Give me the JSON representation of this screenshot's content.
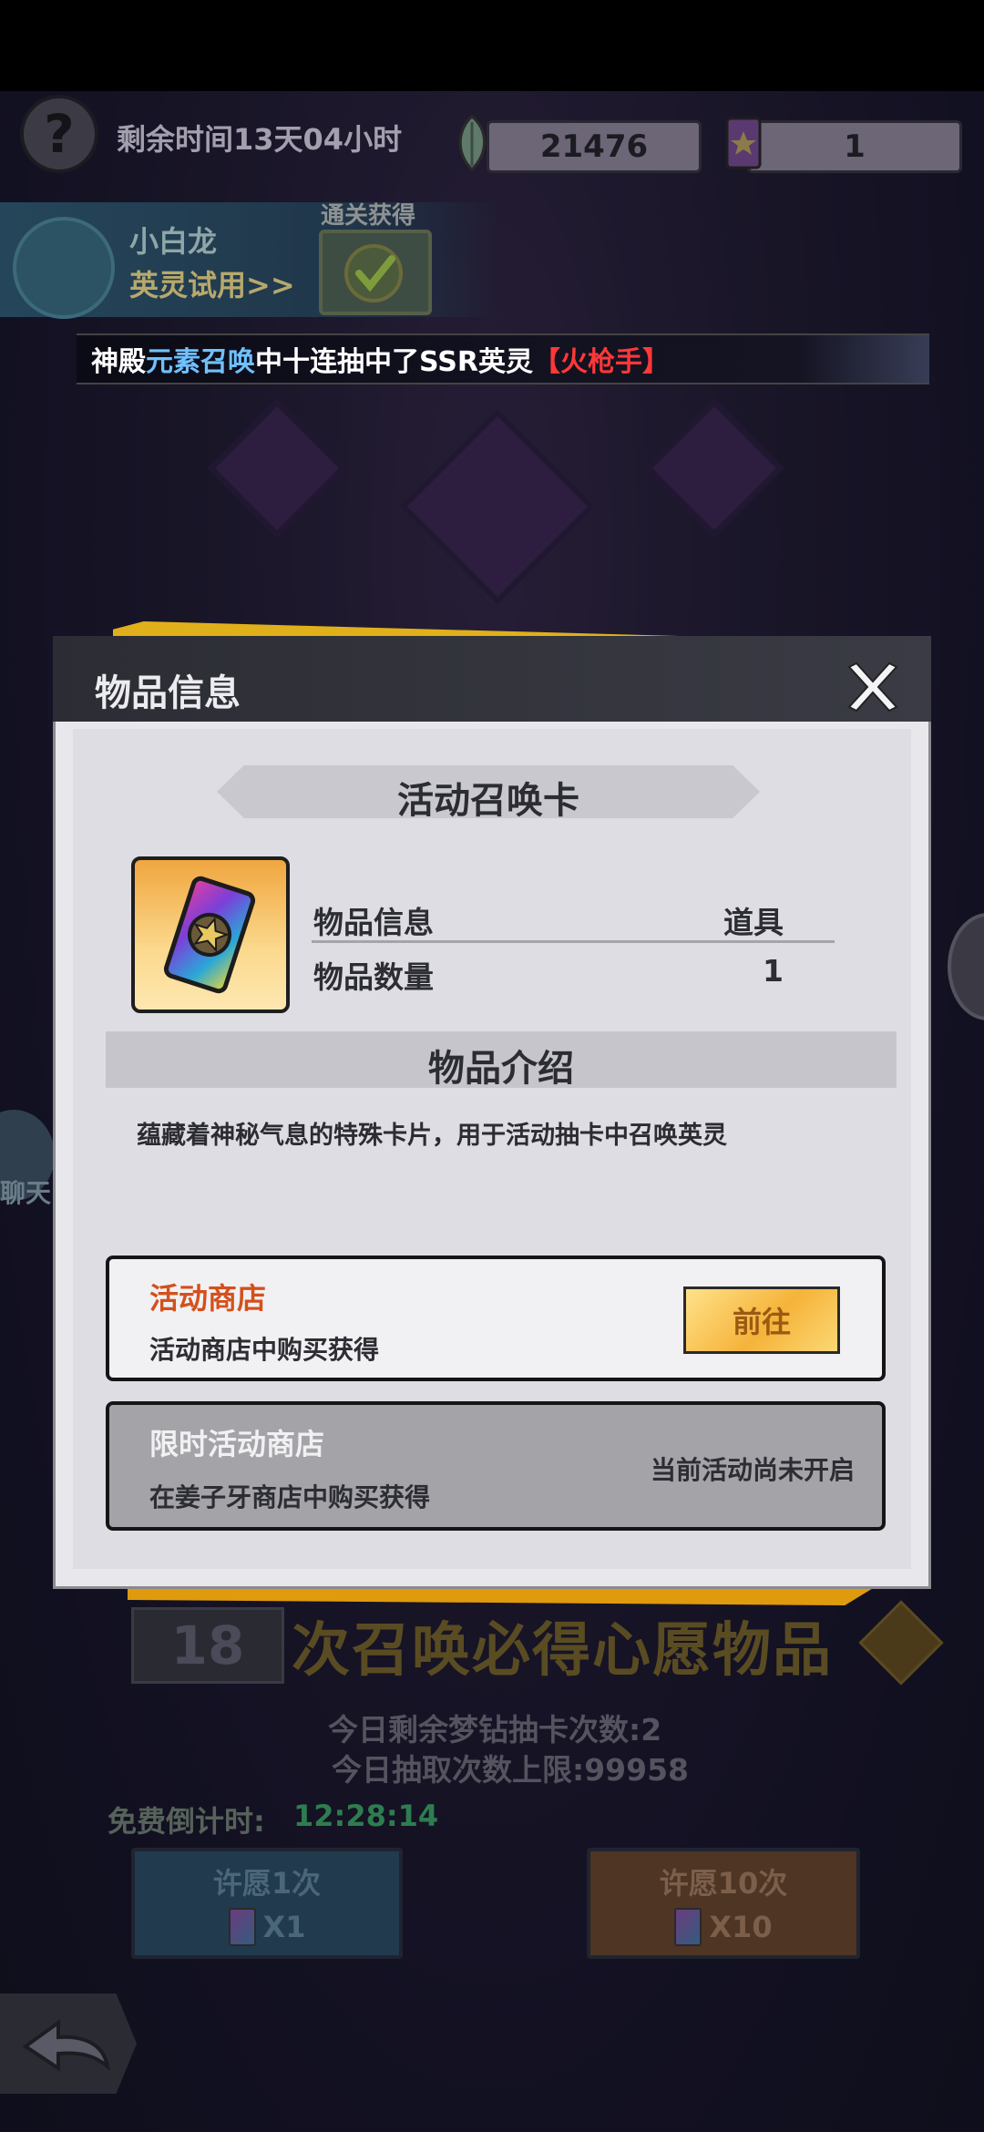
{
  "top_bar": {
    "remaining_time": "剩余时间13天04小时",
    "resources": [
      {
        "icon": "feather-gem-icon",
        "value": "21476"
      },
      {
        "icon": "summon-card-icon",
        "value": "1"
      }
    ]
  },
  "trial_banner": {
    "hero_name": "小白龙",
    "trial_link": "英灵试用>>",
    "reward_label": "通关获得"
  },
  "ticker": {
    "prefix": "神殿",
    "highlight": "元素召唤",
    "middle": "中十连抽中了SSR英灵",
    "hero": "【火枪手】"
  },
  "background_screen": {
    "wish_count": "18",
    "wish_text": "次召唤必得心愿物品",
    "daily_remaining": "今日剩余梦钻抽卡次数:2",
    "daily_limit": "今日抽取次数上限:99958",
    "free_countdown_label": "免费倒计时:",
    "free_countdown_value": "12:28:14",
    "wish_1_label": "许愿1次",
    "wish_1_cost": "X1",
    "wish_10_label": "许愿10次",
    "wish_10_cost": "X10",
    "side_chat_label": "聊天"
  },
  "modal": {
    "title": "物品信息",
    "item_name": "活动召唤卡",
    "info_label": "物品信息",
    "info_value": "道具",
    "count_label": "物品数量",
    "count_value": "1",
    "intro_title": "物品介绍",
    "intro_desc": "蕴藏着神秘气息的特殊卡片，用于活动抽卡中召唤英灵",
    "sources": [
      {
        "name": "活动商店",
        "desc": "活动商店中购买获得",
        "action": "前往"
      },
      {
        "name": "限时活动商店",
        "desc": "在姜子牙商店中购买获得",
        "status": "当前活动尚未开启"
      }
    ]
  },
  "colors": {
    "accent_orange": "#d4501c",
    "highlight_blue": "#6fc1ff",
    "highlight_red": "#ff3838",
    "modal_frame_yellow": "#e0b01a",
    "countdown_green": "#2e7d50"
  }
}
